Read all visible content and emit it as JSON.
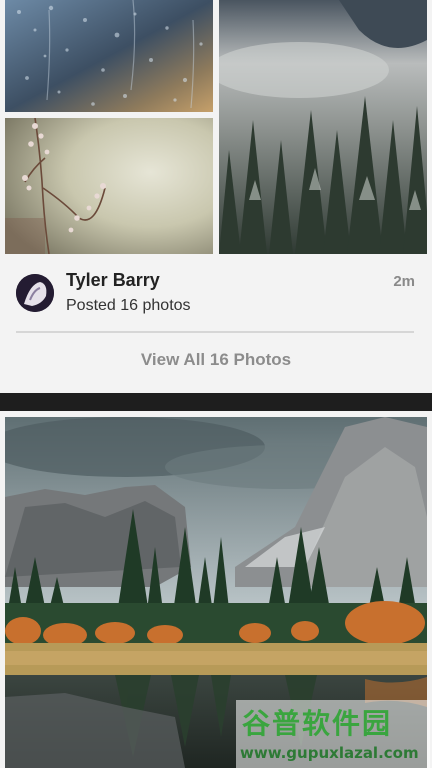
{
  "post": {
    "author": "Tyler Barry",
    "time": "2m",
    "description": "Posted 16 photos",
    "view_all_label": "View All 16 Photos"
  },
  "watermark": {
    "title": "谷普软件园",
    "url": "www.gupuxlazal.com"
  },
  "colors": {
    "card_background": "#f3f3f3",
    "separator_band": "#1e1e1e",
    "muted_text": "#8c8c8c",
    "watermark_green": "#3aa53f"
  }
}
